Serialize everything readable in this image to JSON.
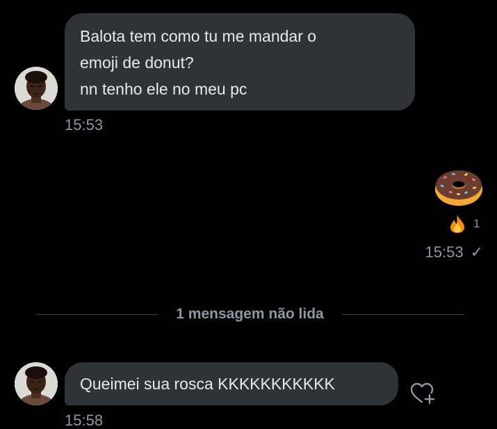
{
  "messages": [
    {
      "direction": "incoming",
      "lines": [
        "Balota tem como tu me mandar o",
        "emoji de donut?",
        "nn tenho ele no meu pc"
      ],
      "time": "15:53"
    },
    {
      "direction": "outgoing",
      "emoji": "donut",
      "reaction": {
        "icon": "fire-icon",
        "count": "1"
      },
      "time": "15:53",
      "status": "✓"
    },
    {
      "direction": "incoming",
      "lines": [
        "Queimei sua rosca KKKKKKKKKKK"
      ],
      "time": "15:58"
    }
  ],
  "unread_divider": "1 mensagem não lida",
  "colors": {
    "background": "#000000",
    "bubble_incoming": "#2f3336",
    "text_primary": "#e7e9ea",
    "text_secondary": "#8b98a5"
  }
}
